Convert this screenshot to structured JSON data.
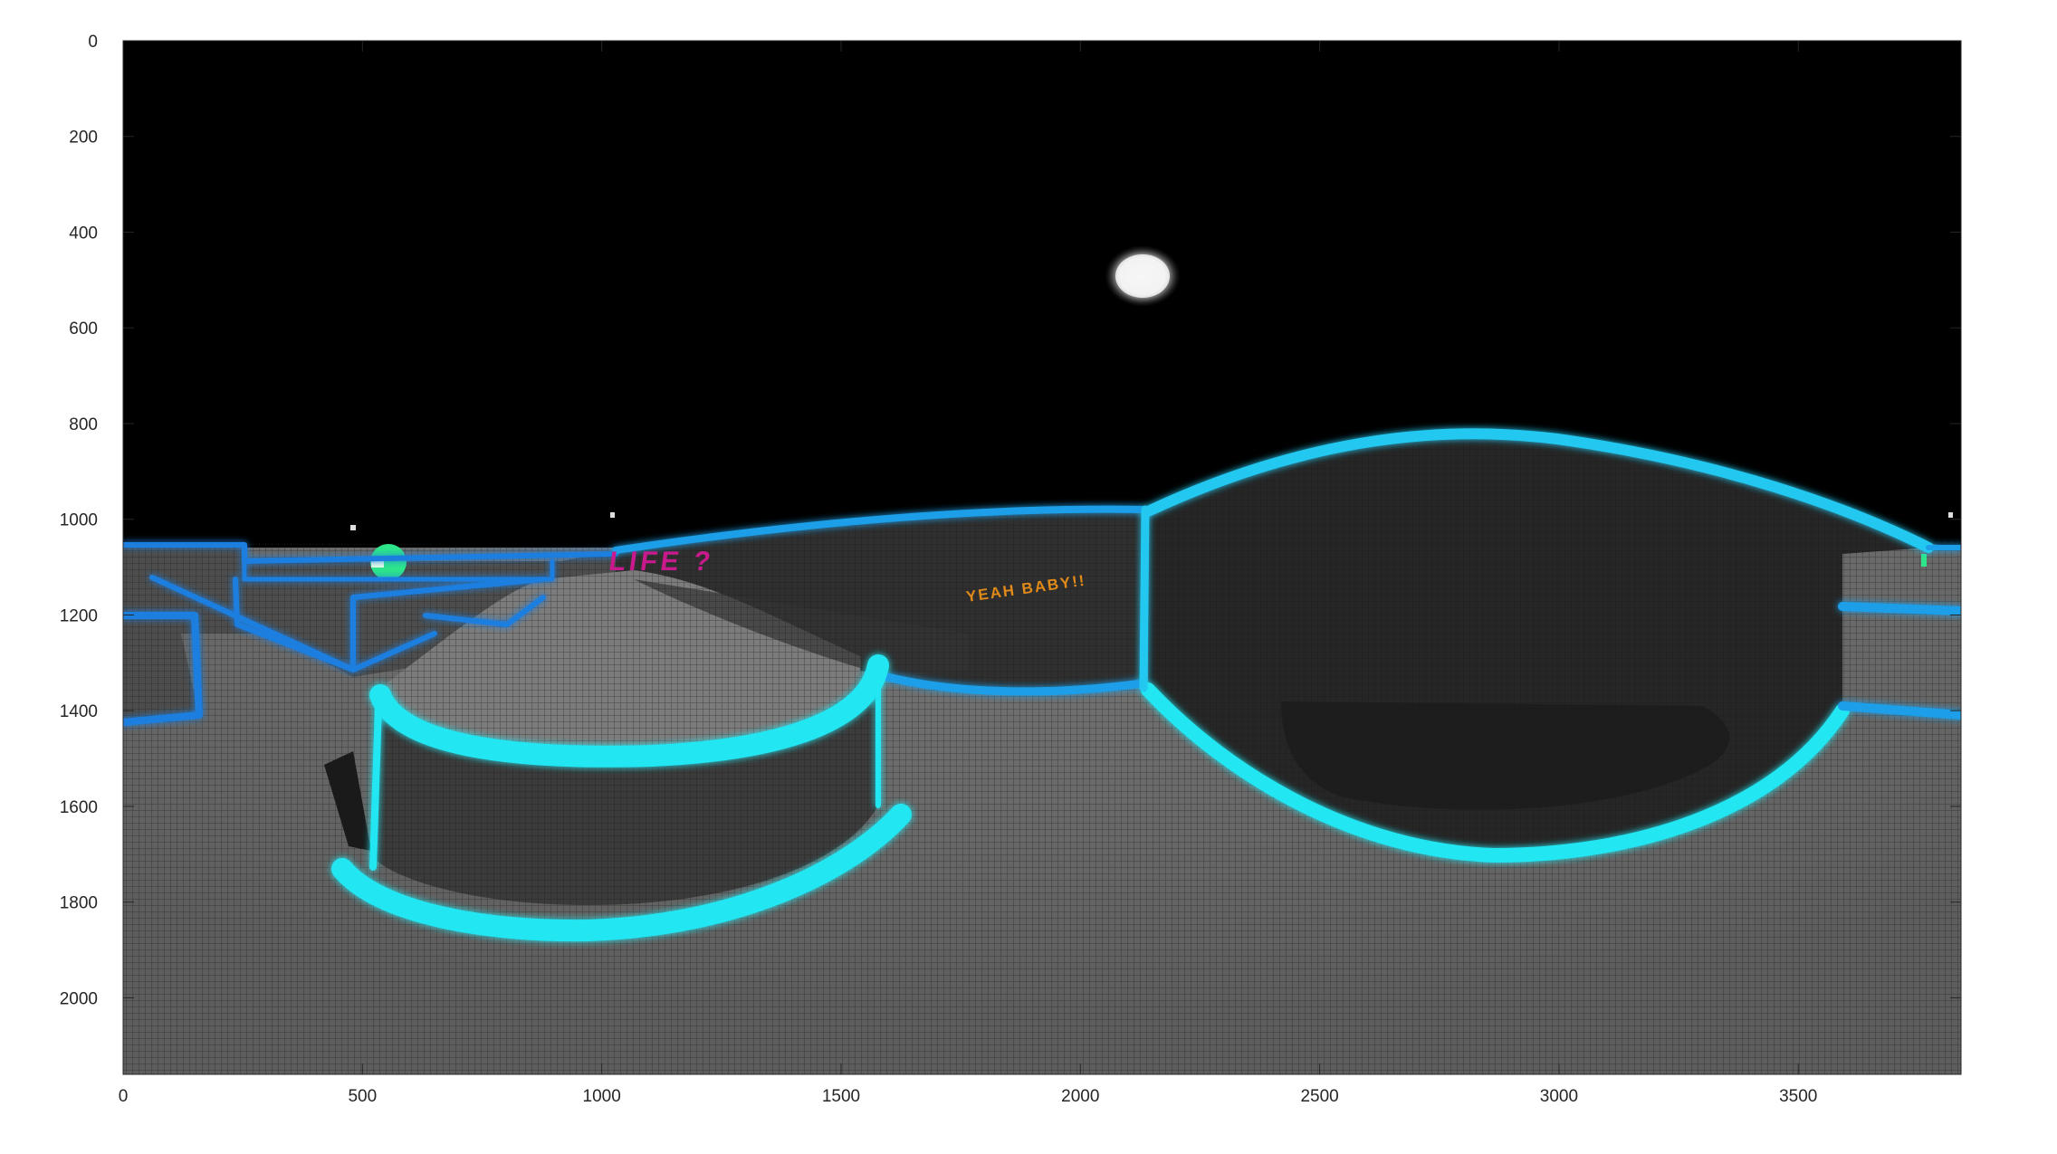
{
  "figure": {
    "x_ticks": [
      "0",
      "500",
      "1000",
      "1500",
      "2000",
      "2500",
      "3000",
      "3500"
    ],
    "y_ticks": [
      "0",
      "200",
      "400",
      "600",
      "800",
      "1000",
      "1200",
      "1400",
      "1600",
      "1800",
      "2000"
    ],
    "xlim": [
      0,
      3840
    ],
    "ylim": [
      0,
      2160
    ],
    "image_text": {
      "magenta_sign": "LIFE ?",
      "orange_sign": "YEAH BABY!!"
    },
    "colors": {
      "sky": "#000000",
      "floor": "#6f6f6f",
      "neon_cyan": "#22e6f2",
      "neon_blue": "#1c7fe0",
      "moon": "#f4f4f4",
      "magenta": "#c81a8c",
      "orange": "#e08a1a",
      "green_orb": "#2ee68a"
    }
  }
}
